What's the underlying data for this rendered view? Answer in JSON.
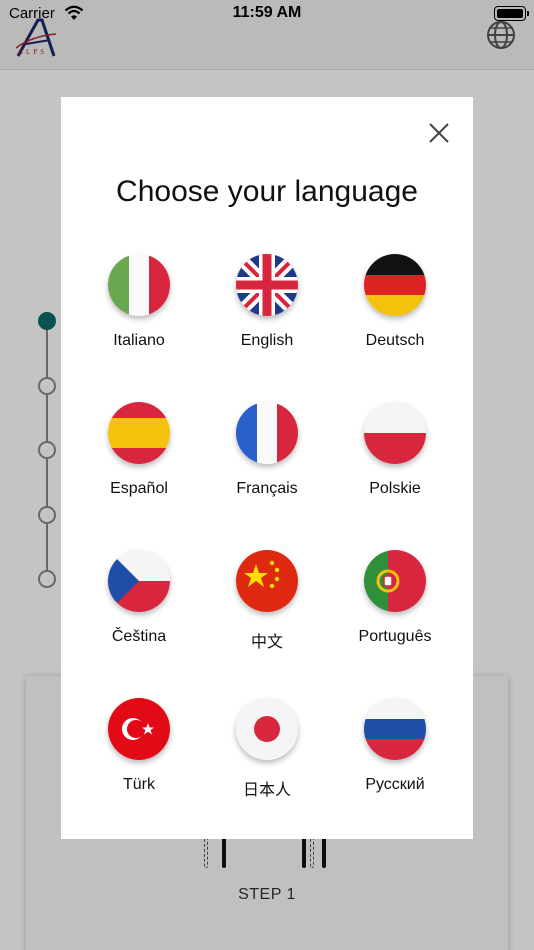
{
  "status_bar": {
    "carrier": "Carrier",
    "time": "11:59 AM"
  },
  "app": {
    "logo_text": "ALPS",
    "step_label": "STEP 1"
  },
  "modal": {
    "title": "Choose your language",
    "languages": [
      {
        "label": "Italiano",
        "flag": "italy-flag"
      },
      {
        "label": "English",
        "flag": "uk-flag"
      },
      {
        "label": "Deutsch",
        "flag": "germany-flag"
      },
      {
        "label": "Español",
        "flag": "spain-flag"
      },
      {
        "label": "Français",
        "flag": "france-flag"
      },
      {
        "label": "Polskie",
        "flag": "poland-flag"
      },
      {
        "label": "Čeština",
        "flag": "czech-flag"
      },
      {
        "label": "中文",
        "flag": "china-flag"
      },
      {
        "label": "Português",
        "flag": "portugal-flag"
      },
      {
        "label": "Türk",
        "flag": "turkey-flag"
      },
      {
        "label": "日本人",
        "flag": "japan-flag"
      },
      {
        "label": "Русский",
        "flag": "russia-flag"
      }
    ]
  },
  "colors": {
    "accent": "#0b6b6b",
    "overlay": "#c4c4c4"
  }
}
